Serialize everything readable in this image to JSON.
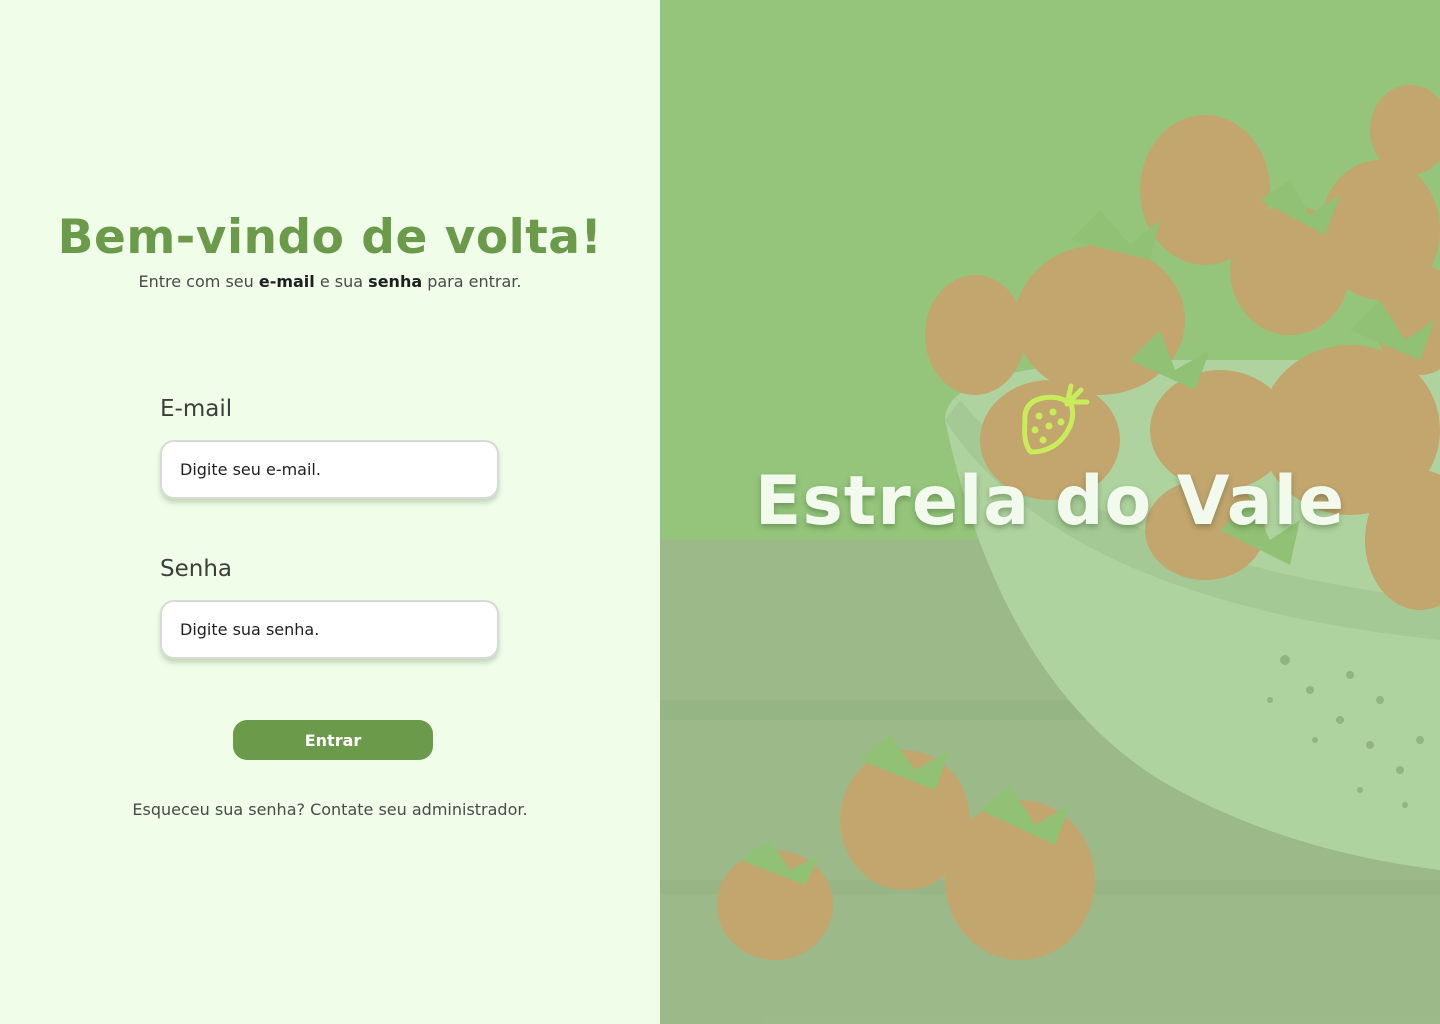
{
  "login": {
    "title": "Bem-vindo de volta!",
    "subtitle": {
      "part1": "Entre com seu ",
      "email_word": "e-mail",
      "part2": " e sua ",
      "password_word": "senha",
      "part3": " para entrar."
    },
    "email": {
      "label": "E-mail",
      "placeholder": "Digite seu e-mail.",
      "value": ""
    },
    "password": {
      "label": "Senha",
      "placeholder": "Digite sua senha.",
      "value": ""
    },
    "submit_label": "Entrar",
    "help_text": "Esqueceu sua senha? Contate seu administrador."
  },
  "brand": {
    "name": "Estrela do Vale",
    "logo_icon": "strawberry-icon"
  },
  "colors": {
    "accent": "#6a9a4a",
    "left_background": "#effde9",
    "logo": "#c8ec5a",
    "brand_text": "#f1faec"
  }
}
